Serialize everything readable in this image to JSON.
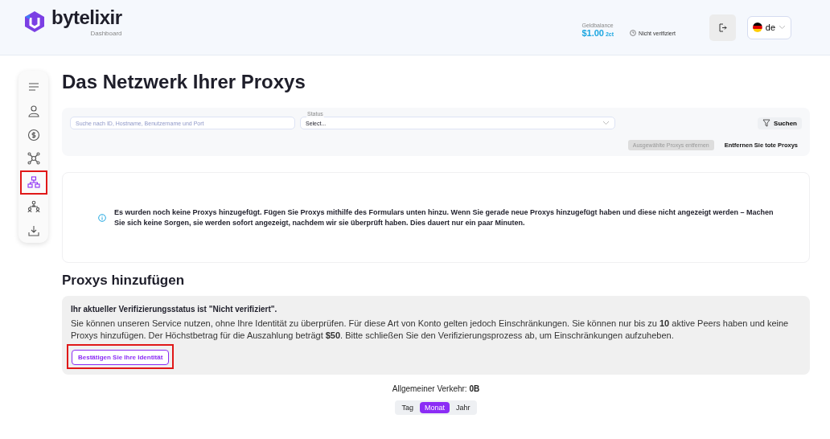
{
  "header": {
    "brand": "bytelixir",
    "subtitle": "Dashboard",
    "balance_label": "Geldbalance",
    "balance": "$1.00",
    "balance_suffix": "2ct",
    "verification": "Nicht verifiziert",
    "language": "de"
  },
  "sidebar": {
    "items": [
      {
        "selected": false,
        "highlighted": false
      },
      {
        "selected": false,
        "highlighted": false
      },
      {
        "selected": false,
        "highlighted": false
      },
      {
        "selected": false,
        "highlighted": false
      },
      {
        "selected": true,
        "highlighted": true
      },
      {
        "selected": false,
        "highlighted": false
      },
      {
        "selected": false,
        "highlighted": false
      }
    ]
  },
  "title": "Das Netzwerk Ihrer Proxys",
  "filters": {
    "search_placeholder": "Suche nach ID, Hostname, Benutzername und Port",
    "status_label": "Status",
    "status_value": "Select...",
    "search_button": "Suchen",
    "remove_selected": {
      "label": "Ausgewählte Proxys entfernen",
      "disabled": true
    },
    "remove_dead": "Entfernen Sie tote Proxys"
  },
  "empty_notice": "Es wurden noch keine Proxys hinzugefügt. Fügen Sie Proxys mithilfe des Formulars unten hinzu. Wenn Sie gerade neue Proxys hinzugefügt haben und diese nicht angezeigt werden – Machen Sie sich keine Sorgen, sie werden sofort angezeigt, nachdem wir sie überprüft haben. Dies dauert nur ein paar Minuten.",
  "add_section": {
    "heading": "Proxys hinzufügen",
    "status_title": "Ihr aktueller Verifizierungsstatus ist \"Nicht verifiziert\".",
    "text": "Sie können unseren Service nutzen, ohne Ihre Identität zu überprüfen. Für diese Art von Konto gelten jedoch Einschränkungen. Sie können nur bis zu **10** aktive Peers haben und keine Proxys hinzufügen. Der Höchstbetrag für die Auszahlung beträgt **$50**. Bitte schließen Sie den Verifizierungsprozess ab, um Einschränkungen aufzuheben.",
    "button": "Bestätigen Sie Ihre Identität",
    "button_highlighted": true
  },
  "traffic": {
    "text": "Allgemeiner Verkehr: **0B**"
  },
  "periods": [
    {
      "label": "Tag",
      "selected": false
    },
    {
      "label": "Monat",
      "selected": true
    },
    {
      "label": "Jahr",
      "selected": false
    }
  ]
}
